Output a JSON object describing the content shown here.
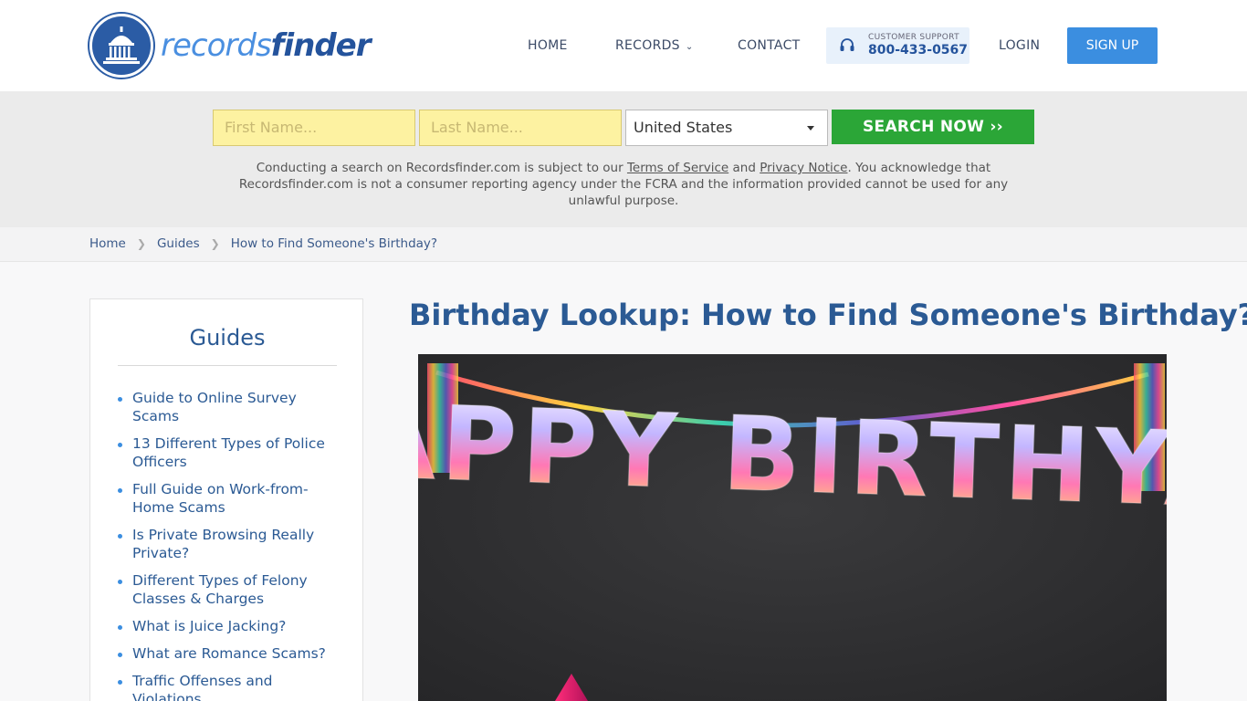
{
  "logo": {
    "part1": "records",
    "part2": "finder"
  },
  "nav": {
    "home": "HOME",
    "records": "RECORDS",
    "contact": "CONTACT",
    "support_label": "CUSTOMER SUPPORT",
    "support_phone": "800-433-0567",
    "login": "LOGIN",
    "signup": "SIGN UP"
  },
  "search": {
    "first_placeholder": "First Name...",
    "last_placeholder": "Last Name...",
    "country": "United States",
    "button": "SEARCH NOW ››"
  },
  "disclaimer": {
    "pre": "Conducting a search on Recordsfinder.com is subject to our ",
    "tos": "Terms of Service",
    "and": " and ",
    "privacy": "Privacy Notice",
    "post": ". You acknowledge that Recordsfinder.com is not a consumer reporting agency under the FCRA and the information provided cannot be used for any unlawful purpose."
  },
  "breadcrumb": {
    "home": "Home",
    "guides": "Guides",
    "current": "How to Find Someone's Birthday?"
  },
  "sidebar": {
    "title": "Guides",
    "items": [
      {
        "label": "Guide to Online Survey Scams"
      },
      {
        "label": "13 Different Types of Police Officers"
      },
      {
        "label": "Full Guide on Work-from-Home Scams"
      },
      {
        "label": "Is Private Browsing Really Private?"
      },
      {
        "label": "Different Types of Felony Classes & Charges"
      },
      {
        "label": "What is Juice Jacking?"
      },
      {
        "label": "What are Romance Scams?"
      },
      {
        "label": "Traffic Offenses and Violations"
      }
    ]
  },
  "main": {
    "title": "Birthday Lookup: How to Find Someone's Birthday?",
    "hero_text": "HAPPY BIRTHYAY"
  },
  "colors": {
    "brand_blue": "#2b5a94",
    "signup_blue": "#3b8ee0",
    "search_green": "#2ba637",
    "field_yellow": "#fdf2a1"
  }
}
